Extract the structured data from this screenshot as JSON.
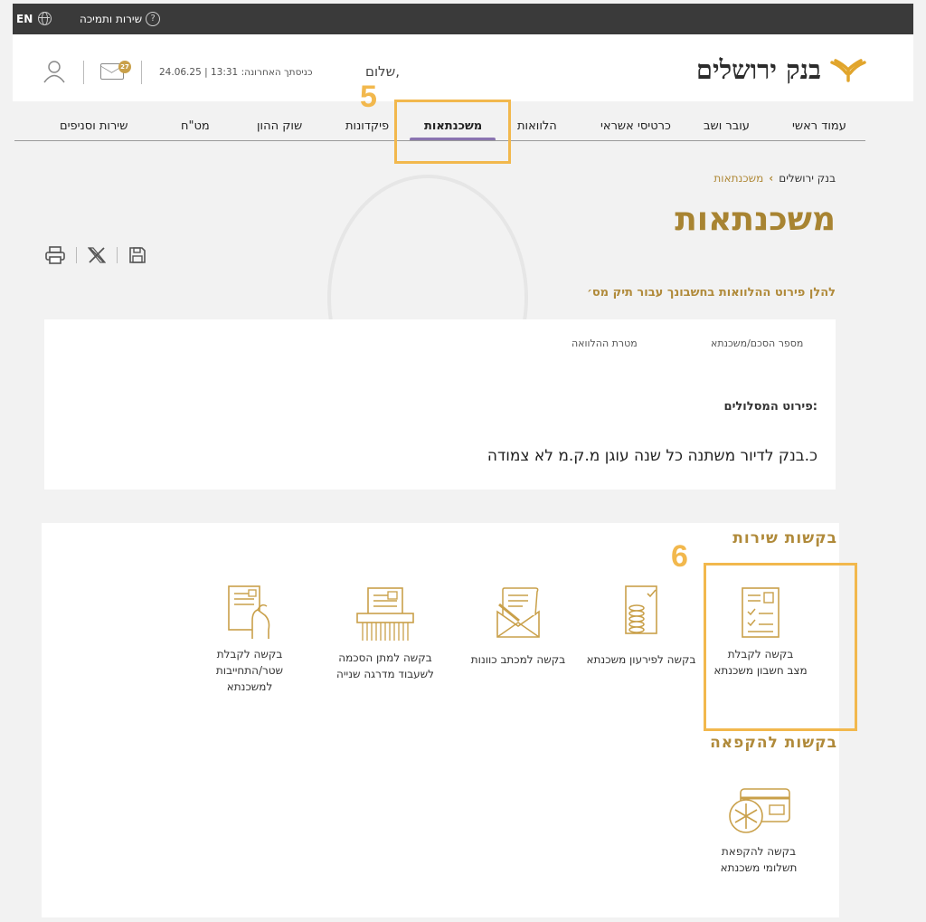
{
  "topbar": {
    "language": "EN",
    "support": "שירות ותמיכה"
  },
  "header": {
    "bank_name": "בנק ירושלים",
    "greeting": "שלום,",
    "last_login": "24.06.25 | 13:31 :כניסתך האחרונה",
    "mail_count": "27"
  },
  "nav": {
    "items": [
      "עמוד ראשי",
      "עובר ושב",
      "כרטיסי אשראי",
      "הלוואות",
      "משכנתאות",
      "פיקדונות",
      "שוק ההון",
      "מט\"ח",
      "שירות וסניפים"
    ],
    "active": "משכנתאות"
  },
  "annotations": {
    "step5": "5",
    "step6": "6"
  },
  "breadcrumb": {
    "root": "בנק ירושלים",
    "current": "משכנתאות"
  },
  "page": {
    "title": "משכנתאות",
    "subtitle": "להלן פירוט ההלוואות בחשבונך עבור תיק מס׳"
  },
  "loan_card": {
    "col_agreement": "מספר הסכם/משכנתא",
    "col_purpose": "מטרת ההלוואה",
    "routes_label": "פירוט המסלולים:",
    "route": "כ.בנק לדיור משתנה כל שנה עוגן מ.ק.מ לא צמודה"
  },
  "service_requests": {
    "title": "בקשות שירות",
    "items": [
      {
        "line1": "בקשה לקבלת",
        "line2": "מצב חשבון משכנתא",
        "icon": "document-list-icon"
      },
      {
        "line1": "בקשה לפירעון משכנתא",
        "line2": "",
        "icon": "coins-icon"
      },
      {
        "line1": "בקשה למכתב כוונות",
        "line2": "",
        "icon": "letter-envelope-icon"
      },
      {
        "line1": "בקשה למתן הסכמה",
        "line2": "לשעבוד מדרגה שנייה",
        "icon": "document-shredder-icon"
      },
      {
        "line1": "בקשה לקבלת",
        "line2": "שטר/התחייבות",
        "line3": "למשכנתא",
        "icon": "hand-document-icon"
      }
    ]
  },
  "freeze_requests": {
    "title": "בקשות להקפאה",
    "items": [
      {
        "line1": "בקשה להקפאת",
        "line2": "תשלומי משכנתא",
        "icon": "card-snowflake-icon"
      }
    ]
  },
  "colors": {
    "gold": "#b08a3a",
    "annotation": "#f2b84d",
    "nav_underline": "#8a74b0"
  }
}
